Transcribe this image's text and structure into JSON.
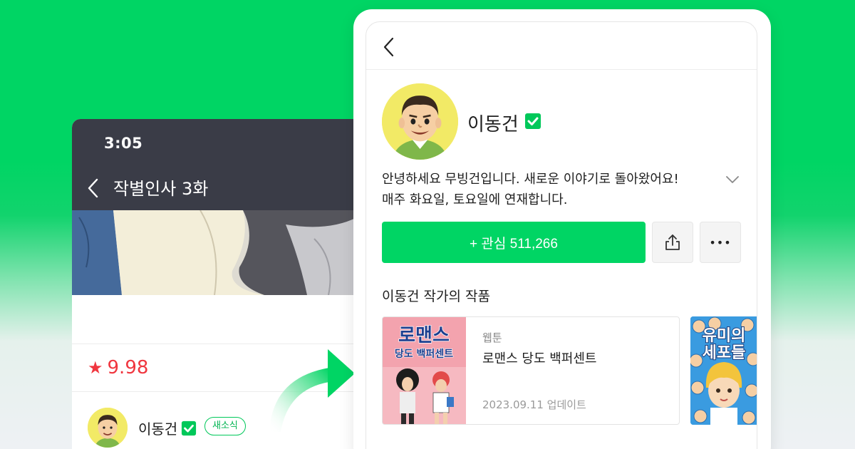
{
  "left_screen": {
    "status_time": "3:05",
    "episode_title": "작별인사 3화",
    "rating_star": "★",
    "rating": "9.98",
    "author_name": "이동건",
    "news_badge": "새소식"
  },
  "profile": {
    "author_name": "이동건",
    "bio_line1": "안녕하세요 무빙건입니다. 새로운 이야기로 돌아왔어요!",
    "bio_line2": "매주 화요일, 토요일에 연재합니다.",
    "follow_button": "+ 관심 511,266",
    "more_glyph": "•••",
    "works_heading": "이동건 작가의 작품",
    "works": [
      {
        "genre": "웹툰",
        "title": "로맨스 당도 백퍼센트",
        "updated": "2023.09.11 업데이트",
        "cover_title_line1": "로맨스",
        "cover_title_line2": "당도 백퍼센트"
      },
      {
        "cover_title_line1": "유미의",
        "cover_title_line2": "세포들"
      }
    ]
  },
  "colors": {
    "brand_green": "#00d564",
    "header_dark": "#3a3c47",
    "rating_red": "#f0363f"
  },
  "icons": [
    "back-chevron-icon",
    "verified-check-icon",
    "chevron-down-icon",
    "share-icon",
    "more-icon",
    "curved-arrow-icon",
    "star-icon"
  ]
}
